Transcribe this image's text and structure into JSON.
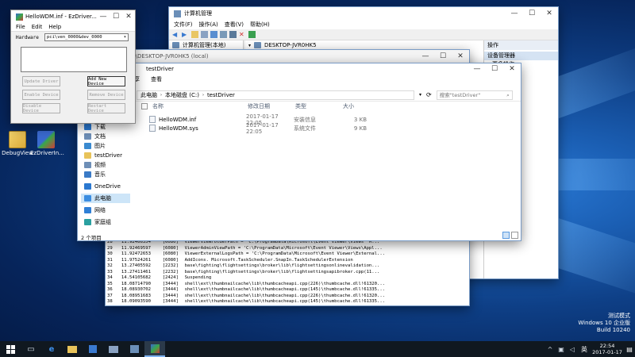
{
  "desktop": {
    "icons": [
      {
        "label": "DebugView"
      },
      {
        "label": "EzDriverIn..."
      }
    ],
    "watermark": {
      "line1": "测试模式",
      "line2": "Windows 10 企业版",
      "line3": "Build 10240"
    }
  },
  "ezdriver": {
    "title": "HelloWDM.inf - EzDriver...",
    "menu": [
      "File",
      "Edit",
      "Help"
    ],
    "hardware_label": "Hardware",
    "hardware_value": "pci\\ven_0000&dev_0000",
    "buttons": {
      "update": "Update Driver",
      "add": "Add New Device",
      "enable": "Enable Device",
      "remove": "Remove Device",
      "disable": "Disable Device",
      "restart": "Restart Device"
    }
  },
  "compmgmt": {
    "title": "计算机管理",
    "menu": [
      "文件(F)",
      "操作(A)",
      "查看(V)",
      "帮助(H)"
    ],
    "tree_root": "计算机管理(本地)",
    "device_root": "DESKTOP-JVR0HK5",
    "actions_header": "操作",
    "actions_item": "设备管理器",
    "actions_sub": "更多操作"
  },
  "debugview": {
    "title": "view on \\\\DESKTOP-JVR0HK5 (local)",
    "rows": [
      {
        "n": "28",
        "t": "11.92466354",
        "pid": "[6080]",
        "msg": "ViewerViewFolderPath = 'C:\\ProgramData\\Microsoft\\Event Viewer\\Views'  M..."
      },
      {
        "n": "29",
        "t": "11.92469597",
        "pid": "[6080]",
        "msg": "ViewerAdminViewPath = 'C:\\ProgramData\\Microsoft\\Event Viewer\\Views\\Appl..."
      },
      {
        "n": "30",
        "t": "11.92472653",
        "pid": "[6080]",
        "msg": "ViewerExternalLogsPath = 'C:\\ProgramData\\Microsoft\\Event Viewer\\External..."
      },
      {
        "n": "31",
        "t": "11.97524261",
        "pid": "[6080]",
        "msg": "AddIcons. Microsoft.TaskScheduler.SnapIn.TaskSchedulerExtension"
      },
      {
        "n": "32",
        "t": "13.27405592",
        "pid": "[2232]",
        "msg": "base\\fighting\\flightsettings\\broker\\lib\\flightsettingsonlinevalidation..."
      },
      {
        "n": "33",
        "t": "13.27411461",
        "pid": "[2232]",
        "msg": "base\\fighting\\flightsettings\\broker\\lib\\flightsettingsapibroker.cpp(11..."
      },
      {
        "n": "34",
        "t": "14.54105682",
        "pid": "[2424]",
        "msg": "Suspending"
      },
      {
        "n": "35",
        "t": "18.08714790",
        "pid": "[3444]",
        "msg": "shell\\ext\\thumbnailcache\\lib\\thumbcacheapi.cpp(226)\\thumbcache.dll!61320..."
      },
      {
        "n": "36",
        "t": "18.08930702",
        "pid": "[3444]",
        "msg": "shell\\ext\\thumbnailcache\\lib\\thumbcacheapi.cpp(145)\\thumbcache.dll!61335..."
      },
      {
        "n": "37",
        "t": "18.08951683",
        "pid": "[3444]",
        "msg": "shell\\ext\\thumbnailcache\\lib\\thumbcacheapi.cpp(226)\\thumbcache.dll!61320..."
      },
      {
        "n": "38",
        "t": "18.09093590",
        "pid": "[3444]",
        "msg": "shell\\ext\\thumbnailcache\\lib\\thumbcacheapi.cpp(145)\\thumbcache.dll!61335..."
      }
    ]
  },
  "explorer": {
    "title": "testDriver",
    "menu": [
      "共享",
      "查看"
    ],
    "breadcrumb": [
      "此电脑",
      "本地磁盘 (C:)",
      "testDriver"
    ],
    "search_placeholder": "搜索\"testDriver\"",
    "columns": [
      "名称",
      "修改日期",
      "类型",
      "大小"
    ],
    "files": [
      {
        "name": "HelloWDM.inf",
        "date": "2017-01-17 22:05",
        "type": "安装信息",
        "size": "3 KB"
      },
      {
        "name": "HelloWDM.sys",
        "date": "2017-01-17 22:05",
        "type": "系统文件",
        "size": "9 KB"
      }
    ],
    "nav": [
      {
        "label": "下载",
        "color": "#2a7bd6"
      },
      {
        "label": "文档",
        "color": "#6e8fb7"
      },
      {
        "label": "图片",
        "color": "#3a8ad0"
      },
      {
        "label": "testDriver",
        "color": "#e8c35a"
      },
      {
        "label": "视频",
        "color": "#6e8fb7"
      },
      {
        "label": "音乐",
        "color": "#3a7ac6"
      },
      {
        "label": "OneDrive",
        "color": "#2b78d0"
      },
      {
        "label": "此电脑",
        "color": "#3b8de0"
      },
      {
        "label": "网络",
        "color": "#2f7fd6"
      },
      {
        "label": "家庭组",
        "color": "#2aa0a0"
      }
    ],
    "status": "2 个项目"
  },
  "taskbar": {
    "time": "22:54",
    "date": "2017-01-17",
    "ime": "英"
  }
}
